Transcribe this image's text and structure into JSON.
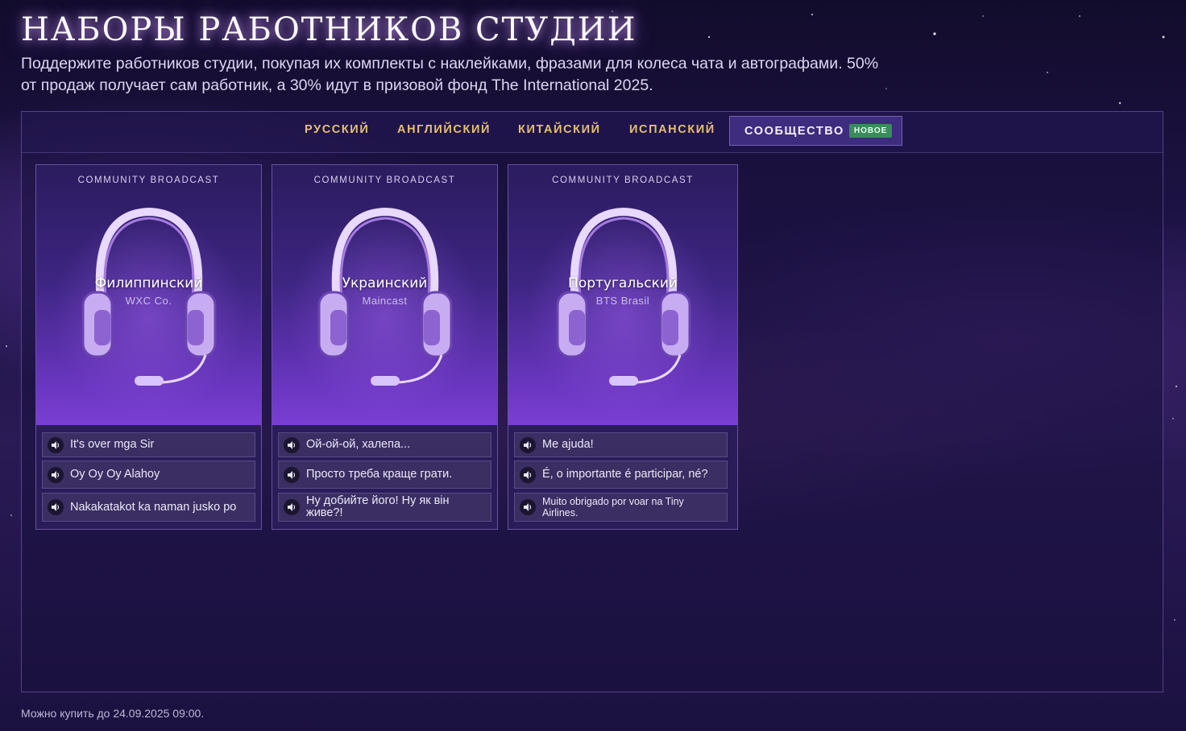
{
  "page": {
    "title": "НАБОРЫ РАБОТНИКОВ СТУДИИ",
    "subtitle": "Поддержите работников студии, покупая их комплекты с наклейками, фразами для колеса чата и автографами. 50% от продаж получает сам работник, а 30% идут в призовой фонд The International 2025.",
    "footer": "Можно купить до 24.09.2025 09:00."
  },
  "tabs": [
    {
      "label": "РУССКИЙ",
      "active": false
    },
    {
      "label": "АНГЛИЙСКИЙ",
      "active": false
    },
    {
      "label": "КИТАЙСКИЙ",
      "active": false
    },
    {
      "label": "ИСПАНСКИЙ",
      "active": false
    },
    {
      "label": "СООБЩЕСТВО",
      "active": true,
      "badge": "НОВОЕ"
    }
  ],
  "cards": [
    {
      "header": "COMMUNITY BROADCAST",
      "language": "Филиппинский",
      "caster": "WXC Co.",
      "phrases": [
        "It's over mga Sir",
        "Oy Oy Oy Alahoy",
        "Nakakatakot ka naman jusko po"
      ]
    },
    {
      "header": "COMMUNITY BROADCAST",
      "language": "Украинский",
      "caster": "Maincast",
      "phrases": [
        "Ой-ой-ой, халепа...",
        "Просто треба краще грати.",
        "Ну добийте його! Ну як він живе?!"
      ]
    },
    {
      "header": "COMMUNITY BROADCAST",
      "language": "Португальский",
      "caster": "BTS Brasil",
      "phrases": [
        "Me ajuda!",
        "É, o importante é participar, né?",
        "Muito obrigado por voar na Tiny Airlines."
      ]
    }
  ],
  "icons": {
    "phrase": "speaker-icon",
    "card_art": "headphones-icon"
  },
  "colors": {
    "tab_text": "#e6bf74",
    "badge": "#3a8c5c",
    "accent_purple": "#7a3fd3"
  }
}
